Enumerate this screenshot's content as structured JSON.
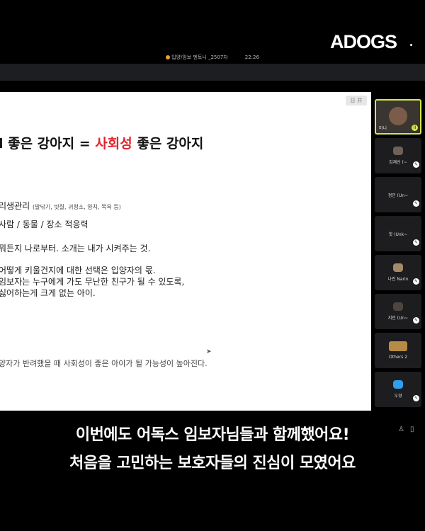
{
  "brand": {
    "logo": "ADOGS"
  },
  "meeting": {
    "title": "입양/임보 멘토니 _2507차",
    "time": "22:26"
  },
  "slide": {
    "title_part1": "l 좋은 강아지 = ",
    "title_highlight": "사회성",
    "title_part2": " 좋은 강아지",
    "line1": "리생관리",
    "line1_note": "(발닦기, 빗질, 귀청소, 양치, 목욕 등)",
    "line2": "사람 / 동물 / 장소 적응력",
    "line3": "뭐든지 나로부터. 소개는 내가 시켜주는 것.",
    "line4": "어떻게 키울건지에 대한 선택은 입양자의 몫.",
    "line5": "임보자는 누구에게 가도 무난한 친구가 될 수 있도록,",
    "line6": "싫어하는게 크게 없는 아이.",
    "footer": "양자가 반려했을 때 사회성이 좋은 아이가 될 가능성이 높아진다.",
    "ctrl1": "日",
    "ctrl2": "井"
  },
  "participants": [
    {
      "name": "마니",
      "mic": "II"
    },
    {
      "name": "김재선 (~",
      "mic": "✎"
    },
    {
      "name": "정민 (Un~",
      "mic": "✎"
    },
    {
      "name": "핫 (Unk~",
      "mic": "✎"
    },
    {
      "name": "나린 Narin",
      "mic": "✎"
    },
    {
      "name": "지민 (Un~",
      "mic": "✎"
    },
    {
      "name": "Others 2",
      "mic": ""
    },
    {
      "name": "우경",
      "mic": "✎"
    }
  ],
  "bottom_icons": {
    "person": "♙",
    "panel": "▯"
  },
  "captions": {
    "line1": "이번에도 어독스 임보자님들과 함께했어요!",
    "line2": "처음을 고민하는 보호자들의 진심이 모였어요"
  }
}
